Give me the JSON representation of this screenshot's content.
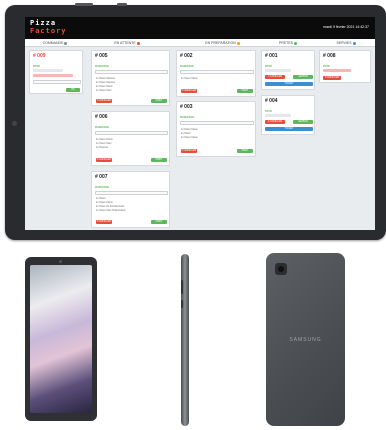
{
  "app": {
    "logo_line1": "Pizza",
    "logo_line2": "Factory",
    "datetime": "mardi 9 février 2021 14:42:37"
  },
  "columns": [
    {
      "label": "COMMANDE",
      "dot_color": "#7f8c8d"
    },
    {
      "label": "EN ATTENTE",
      "dot_color": "#e74c3c"
    },
    {
      "label": "EN PREPARATION",
      "dot_color": "#f39c12"
    },
    {
      "label": "PRETES",
      "dot_color": "#5cb85c"
    },
    {
      "label": "SERVIES",
      "dot_color": "#3b8ed0"
    }
  ],
  "orders": {
    "c1": {
      "id": "# 009",
      "status": "PAYE",
      "btn": "OK"
    },
    "w1": {
      "id": "# 005",
      "status": "RAMASSE",
      "items": [
        "1x Xxxxx Xxxxxxx",
        "1x Xxxxx Xxxxxxx",
        "1x Xxxxx Xxxxx",
        "1x Xxxxx Xxxx"
      ],
      "btn_cancel": "X ANNULER",
      "btn_ok": "PRET"
    },
    "w2": {
      "id": "# 006",
      "status": "RAMASSE",
      "items": [
        "1x Xxxxx Xxxxx",
        "1x Xxxxx Xxxx",
        "1x Xxxxxxx"
      ],
      "btn_cancel": "X ANNULER",
      "btn_ok": "PRET"
    },
    "w3": {
      "id": "# 007",
      "status": "RAMASSE",
      "items": [
        "1x Xxxxx",
        "1x Xxxxx Xxxxx",
        "1x Xxxxx Xx Xxxxxxxxxxxx",
        "1x Xxxxx Xxxx Xxxxxxxxxxx"
      ],
      "btn_cancel": "X ANNULER",
      "btn_ok": "PRET"
    },
    "p1": {
      "id": "# 002",
      "status": "RAMASSE",
      "items": [
        "1x Xxxxx Xxxxx"
      ],
      "btn_cancel": "X ANNULER",
      "btn_ok": "PRET"
    },
    "p2": {
      "id": "# 003",
      "status": "RAMASSE",
      "items": [
        "1x Xxxxx Xxxxx",
        "1x Xxxxx",
        "1x Xxxxx Xxxxx"
      ],
      "btn_cancel": "X ANNULER",
      "btn_ok": "PRET"
    },
    "r1": {
      "id": "# 001",
      "status": "PAYE",
      "btn_cancel": "X ANNULER",
      "btn_ok": "SERVIR",
      "btn_receipt": "TICKET"
    },
    "r2": {
      "id": "# 004",
      "status": "PAYE",
      "btn_cancel": "X ANNULER",
      "btn_ok": "SERVIR",
      "btn_receipt": "TICKET"
    },
    "s1": {
      "id": "# 008",
      "status": "PAYE",
      "btn_cancel": "X ANNULER"
    }
  },
  "device_brand": "SAMSUNG"
}
